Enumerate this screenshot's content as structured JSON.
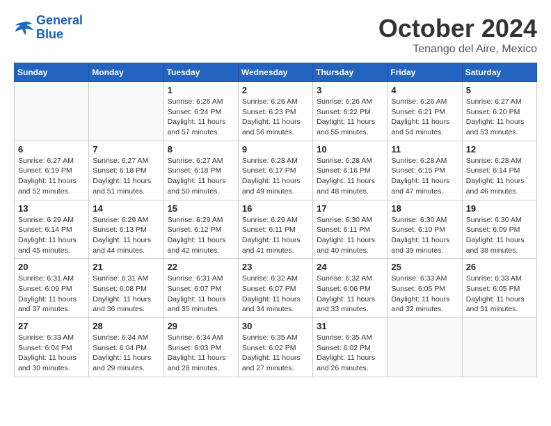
{
  "logo": {
    "line1": "General",
    "line2": "Blue"
  },
  "title": "October 2024",
  "location": "Tenango del Aire, Mexico",
  "days_of_week": [
    "Sunday",
    "Monday",
    "Tuesday",
    "Wednesday",
    "Thursday",
    "Friday",
    "Saturday"
  ],
  "weeks": [
    [
      {
        "day": "",
        "info": ""
      },
      {
        "day": "",
        "info": ""
      },
      {
        "day": "1",
        "info": "Sunrise: 6:26 AM\nSunset: 6:24 PM\nDaylight: 11 hours and 57 minutes."
      },
      {
        "day": "2",
        "info": "Sunrise: 6:26 AM\nSunset: 6:23 PM\nDaylight: 11 hours and 56 minutes."
      },
      {
        "day": "3",
        "info": "Sunrise: 6:26 AM\nSunset: 6:22 PM\nDaylight: 11 hours and 55 minutes."
      },
      {
        "day": "4",
        "info": "Sunrise: 6:26 AM\nSunset: 6:21 PM\nDaylight: 11 hours and 54 minutes."
      },
      {
        "day": "5",
        "info": "Sunrise: 6:27 AM\nSunset: 6:20 PM\nDaylight: 11 hours and 53 minutes."
      }
    ],
    [
      {
        "day": "6",
        "info": "Sunrise: 6:27 AM\nSunset: 6:19 PM\nDaylight: 11 hours and 52 minutes."
      },
      {
        "day": "7",
        "info": "Sunrise: 6:27 AM\nSunset: 6:18 PM\nDaylight: 11 hours and 51 minutes."
      },
      {
        "day": "8",
        "info": "Sunrise: 6:27 AM\nSunset: 6:18 PM\nDaylight: 11 hours and 50 minutes."
      },
      {
        "day": "9",
        "info": "Sunrise: 6:28 AM\nSunset: 6:17 PM\nDaylight: 11 hours and 49 minutes."
      },
      {
        "day": "10",
        "info": "Sunrise: 6:28 AM\nSunset: 6:16 PM\nDaylight: 11 hours and 48 minutes."
      },
      {
        "day": "11",
        "info": "Sunrise: 6:28 AM\nSunset: 6:15 PM\nDaylight: 11 hours and 47 minutes."
      },
      {
        "day": "12",
        "info": "Sunrise: 6:28 AM\nSunset: 6:14 PM\nDaylight: 11 hours and 46 minutes."
      }
    ],
    [
      {
        "day": "13",
        "info": "Sunrise: 6:29 AM\nSunset: 6:14 PM\nDaylight: 11 hours and 45 minutes."
      },
      {
        "day": "14",
        "info": "Sunrise: 6:29 AM\nSunset: 6:13 PM\nDaylight: 11 hours and 44 minutes."
      },
      {
        "day": "15",
        "info": "Sunrise: 6:29 AM\nSunset: 6:12 PM\nDaylight: 11 hours and 42 minutes."
      },
      {
        "day": "16",
        "info": "Sunrise: 6:29 AM\nSunset: 6:11 PM\nDaylight: 11 hours and 41 minutes."
      },
      {
        "day": "17",
        "info": "Sunrise: 6:30 AM\nSunset: 6:11 PM\nDaylight: 11 hours and 40 minutes."
      },
      {
        "day": "18",
        "info": "Sunrise: 6:30 AM\nSunset: 6:10 PM\nDaylight: 11 hours and 39 minutes."
      },
      {
        "day": "19",
        "info": "Sunrise: 6:30 AM\nSunset: 6:09 PM\nDaylight: 11 hours and 38 minutes."
      }
    ],
    [
      {
        "day": "20",
        "info": "Sunrise: 6:31 AM\nSunset: 6:09 PM\nDaylight: 11 hours and 37 minutes."
      },
      {
        "day": "21",
        "info": "Sunrise: 6:31 AM\nSunset: 6:08 PM\nDaylight: 11 hours and 36 minutes."
      },
      {
        "day": "22",
        "info": "Sunrise: 6:31 AM\nSunset: 6:07 PM\nDaylight: 11 hours and 35 minutes."
      },
      {
        "day": "23",
        "info": "Sunrise: 6:32 AM\nSunset: 6:07 PM\nDaylight: 11 hours and 34 minutes."
      },
      {
        "day": "24",
        "info": "Sunrise: 6:32 AM\nSunset: 6:06 PM\nDaylight: 11 hours and 33 minutes."
      },
      {
        "day": "25",
        "info": "Sunrise: 6:33 AM\nSunset: 6:05 PM\nDaylight: 11 hours and 32 minutes."
      },
      {
        "day": "26",
        "info": "Sunrise: 6:33 AM\nSunset: 6:05 PM\nDaylight: 11 hours and 31 minutes."
      }
    ],
    [
      {
        "day": "27",
        "info": "Sunrise: 6:33 AM\nSunset: 6:04 PM\nDaylight: 11 hours and 30 minutes."
      },
      {
        "day": "28",
        "info": "Sunrise: 6:34 AM\nSunset: 6:04 PM\nDaylight: 11 hours and 29 minutes."
      },
      {
        "day": "29",
        "info": "Sunrise: 6:34 AM\nSunset: 6:03 PM\nDaylight: 11 hours and 28 minutes."
      },
      {
        "day": "30",
        "info": "Sunrise: 6:35 AM\nSunset: 6:02 PM\nDaylight: 11 hours and 27 minutes."
      },
      {
        "day": "31",
        "info": "Sunrise: 6:35 AM\nSunset: 6:02 PM\nDaylight: 11 hours and 26 minutes."
      },
      {
        "day": "",
        "info": ""
      },
      {
        "day": "",
        "info": ""
      }
    ]
  ]
}
